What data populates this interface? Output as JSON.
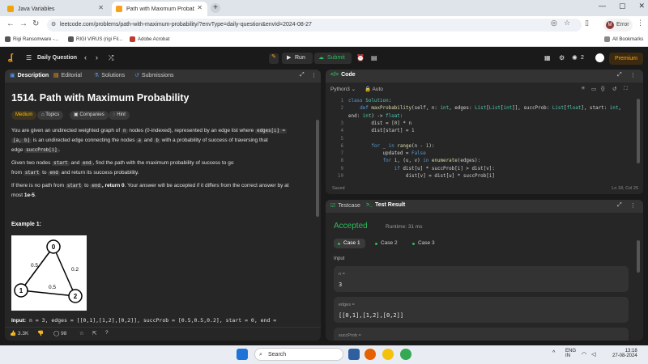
{
  "browser": {
    "tabs": [
      {
        "title": "Java Variables",
        "active": false,
        "favicon_color": "#f0a30a"
      },
      {
        "title": "Path with Maximum Probability",
        "active": true,
        "favicon_color": "#f89f1b"
      }
    ],
    "new_tab": "+",
    "url": "leetcode.com/problems/path-with-maximum-probability/?envType=daily-question&envId=2024-08-27",
    "profile_initial": "M",
    "profile_label": "Error",
    "bookmarks": [
      "Rigi Ransomware -...",
      "RIGI VIRUS (rigi Fil...",
      "Adobe Acrobat"
    ],
    "all_bookmarks": "All Bookmarks"
  },
  "lc_header": {
    "daily_question": "Daily Question",
    "run": "Run",
    "submit": "Submit",
    "streak_count": "2",
    "premium": "Premium"
  },
  "description_panel": {
    "tabs": [
      "Description",
      "Editorial",
      "Solutions",
      "Submissions"
    ],
    "title": "1514. Path with Maximum Probability",
    "chips": [
      "Medium",
      "Topics",
      "Companies",
      "Hint"
    ],
    "p1_a": "You are given an undirected weighted graph of",
    "p1_n": "n",
    "p1_b": "nodes (0-indexed), represented by an edge list where",
    "p1_edges_i": "edges[i] =",
    "p1_ab": "[a, b]",
    "p1_c": "is an undirected edge connecting the nodes",
    "p1_a_code": "a",
    "p1_and": "and",
    "p1_b_code": "b",
    "p1_d": "with a probability of success of traversing that",
    "p1_e": "edge",
    "p1_succ": "succProb[i]",
    "p1_end": ".",
    "p2_a": "Given two nodes",
    "p2_start": "start",
    "p2_and": "and",
    "p2_end_code": "end",
    "p2_b": ", find the path with the maximum probability of success to go",
    "p2_c": "from",
    "p2_start2": "start",
    "p2_to": "to",
    "p2_end2": "end",
    "p2_d": "and return its success probability.",
    "p3_a": "If there is no path from",
    "p3_start": "start",
    "p3_to": "to",
    "p3_end": "end",
    "p3_return": ", return 0",
    "p3_b": ". Your answer will be accepted if it differs from the correct answer by at",
    "p3_c": "most",
    "p3_tol": "1e-5",
    "p3_dot": ".",
    "example_title": "Example 1:",
    "graph": {
      "nodes": [
        "0",
        "1",
        "2"
      ],
      "edges": [
        "0.5",
        "0.2",
        "0.5"
      ]
    },
    "input_label": "Input:",
    "input_value": "n = 3, edges = [[0,1],[1,2],[0,2]], succProb = [0.5,0.5,0.2], start = 0, end =",
    "footer": {
      "likes": "3.3K",
      "comments": "98"
    }
  },
  "code_panel": {
    "title": "Code",
    "language": "Python3",
    "auto": "Auto",
    "lines": [
      {
        "n": "1",
        "html": "<span class='kw'>class</span> <span class='ty'>Solution</span>:"
      },
      {
        "n": "2",
        "html": "    <span class='kw'>def</span> <span class='fn'>maxProbability</span>(self, n: <span class='ty'>int</span>, edges: <span class='ty'>List</span>[<span class='ty'>List</span>[<span class='ty'>int</span>]], succProb: <span class='ty'>List</span>[<span class='ty'>float</span>], start: <span class='ty'>int</span>,"
      },
      {
        "n": "",
        "html": "end: <span class='ty'>int</span>) -> <span class='ty'>float</span>:"
      },
      {
        "n": "3",
        "html": "        dist = [<span class='nm'>0</span>] * n"
      },
      {
        "n": "4",
        "html": "        dist[start] = <span class='nm'>1</span>"
      },
      {
        "n": "5",
        "html": ""
      },
      {
        "n": "6",
        "html": "        <span class='kw'>for</span> _ <span class='kw'>in</span> <span class='fn'>range</span>(n - <span class='nm'>1</span>):"
      },
      {
        "n": "7",
        "html": "            updated = <span class='kw'>False</span>"
      },
      {
        "n": "8",
        "html": "            <span class='kw'>for</span> i, (u, v) <span class='kw'>in</span> <span class='fn'>enumerate</span>(edges):"
      },
      {
        "n": "9",
        "html": "                <span class='kw'>if</span> dist[u] * succProb[i] > dist[v]:"
      },
      {
        "n": "10",
        "html": "                    dist[v] = dist[u] * succProb[i]"
      }
    ],
    "saved": "Saved",
    "cursor": "Ln 18, Col 25"
  },
  "test_panel": {
    "tabs": [
      "Testcase",
      "Test Result"
    ],
    "status": "Accepted",
    "runtime": "Runtime: 31 ms",
    "cases": [
      "Case 1",
      "Case 2",
      "Case 3"
    ],
    "input_label": "Input",
    "inputs": [
      {
        "key": "n =",
        "value": "3"
      },
      {
        "key": "edges =",
        "value": "[[0,1],[1,2],[0,2]]"
      },
      {
        "key": "succProb =",
        "value": ""
      }
    ]
  },
  "taskbar": {
    "search": "Search",
    "lang": "ENG",
    "region": "IN",
    "time": "13:18",
    "date": "27-08-2024"
  }
}
